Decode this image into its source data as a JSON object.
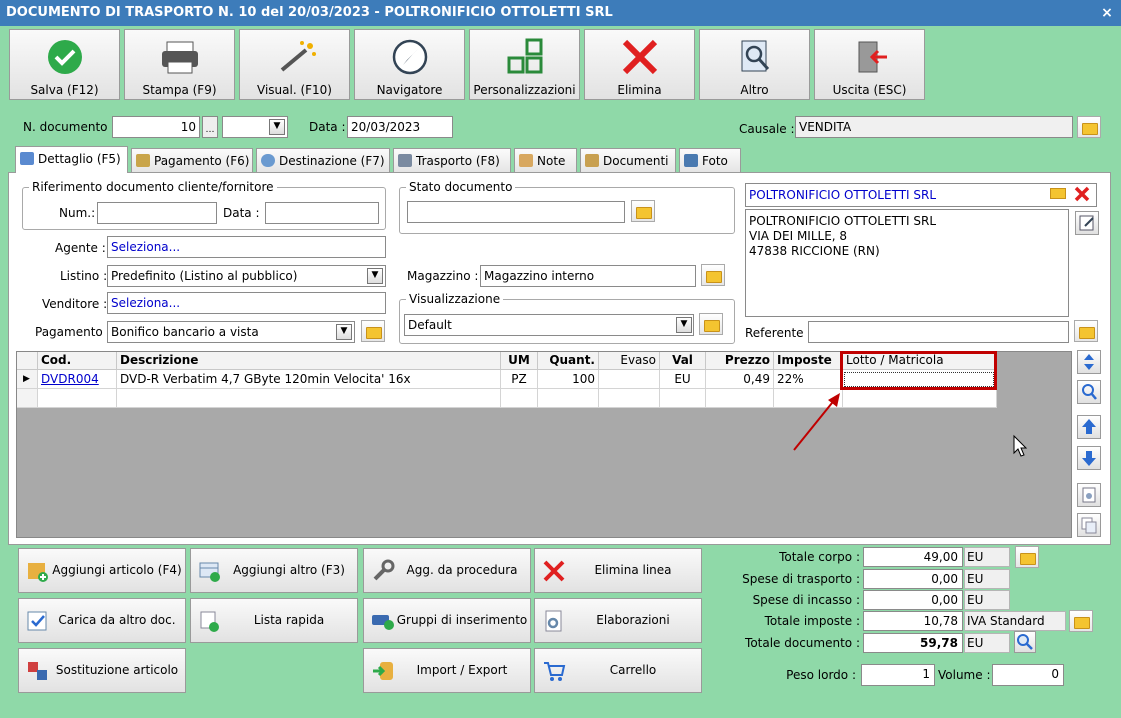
{
  "window": {
    "title": "DOCUMENTO DI TRASPORTO N. 10 del 20/03/2023 - POLTRONIFICIO OTTOLETTI SRL",
    "close": "×"
  },
  "toolbar": {
    "salva": "Salva (F12)",
    "stampa": "Stampa (F9)",
    "visual": "Visual. (F10)",
    "navigatore": "Navigatore",
    "personalizzazioni": "Personalizzazioni",
    "elimina": "Elimina",
    "altro": "Altro",
    "uscita": "Uscita (ESC)"
  },
  "header": {
    "n_documento_label": "N. documento :",
    "n_documento_value": "10",
    "data_label": "Data :",
    "data_value": "20/03/2023",
    "causale_label": "Causale :",
    "causale_value": "VENDITA"
  },
  "tabs": [
    "Dettaglio (F5)",
    "Pagamento (F6)",
    "Destinazione (F7)",
    "Trasporto (F8)",
    "Note",
    "Documenti",
    "Foto"
  ],
  "form": {
    "riferimento_title": "Riferimento documento cliente/fornitore",
    "num_label": "Num.:",
    "data_label": "Data :",
    "stato_title": "Stato documento",
    "agente_label": "Agente :",
    "agente_value": "Seleziona...",
    "listino_label": "Listino :",
    "listino_value": "Predefinito (Listino al pubblico)",
    "venditore_label": "Venditore :",
    "venditore_value": "Seleziona...",
    "pagamento_label": "Pagamento :",
    "pagamento_value": "Bonifico bancario a vista",
    "magazzino_label": "Magazzino :",
    "magazzino_value": "Magazzino interno",
    "visualizzazione_title": "Visualizzazione",
    "visualizzazione_value": "Default",
    "cliente_name": "POLTRONIFICIO OTTOLETTI SRL",
    "address_line1": "POLTRONIFICIO OTTOLETTI SRL",
    "address_line2": "VIA DEI MILLE, 8",
    "address_line3": "47838 RICCIONE (RN)",
    "referente_label": "Referente"
  },
  "grid": {
    "headers": {
      "cod": "Cod.",
      "descrizione": "Descrizione",
      "um": "UM",
      "quant": "Quant.",
      "evaso": "Evaso",
      "val": "Val",
      "prezzo": "Prezzo",
      "imposte": "Imposte",
      "lotto": "Lotto / Matricola"
    },
    "row": {
      "cod": "DVDR004",
      "descrizione": "DVD-R Verbatim 4,7 GByte 120min  Velocita' 16x",
      "um": "PZ",
      "quant": "100",
      "evaso": "",
      "val": "EU",
      "prezzo": "0,49",
      "imposte": "22%",
      "lotto": ""
    }
  },
  "actions": {
    "aggiungi_articolo": "Aggiungi articolo (F4)",
    "aggiungi_altro": "Aggiungi altro (F3)",
    "agg_procedura": "Agg. da procedura",
    "elimina_linea": "Elimina linea",
    "carica": "Carica da altro doc.",
    "lista_rapida": "Lista rapida",
    "gruppi": "Gruppi di inserimento",
    "elaborazioni": "Elaborazioni",
    "sostituzione": "Sostituzione articolo",
    "import_export": "Import / Export",
    "carrello": "Carrello"
  },
  "totals": {
    "totale_corpo_label": "Totale corpo :",
    "totale_corpo": "49,00",
    "totale_corpo_unit": "EU",
    "spese_trasporto_label": "Spese di trasporto :",
    "spese_trasporto": "0,00",
    "spese_trasporto_unit": "EU",
    "spese_incasso_label": "Spese di incasso :",
    "spese_incasso": "0,00",
    "spese_incasso_unit": "EU",
    "totale_imposte_label": "Totale imposte :",
    "totale_imposte": "10,78",
    "totale_imposte_unit": "IVA Standard",
    "totale_documento_label": "Totale documento :",
    "totale_documento": "59,78",
    "totale_documento_unit": "EU",
    "peso_lordo_label": "Peso lordo :",
    "peso_lordo": "1",
    "volume_label": "Volume :",
    "volume": "0"
  },
  "colors": {
    "background": "#8fd9a8",
    "titlebar": "#3d7cba",
    "highlight": "#c00000",
    "link": "#0000cc"
  }
}
